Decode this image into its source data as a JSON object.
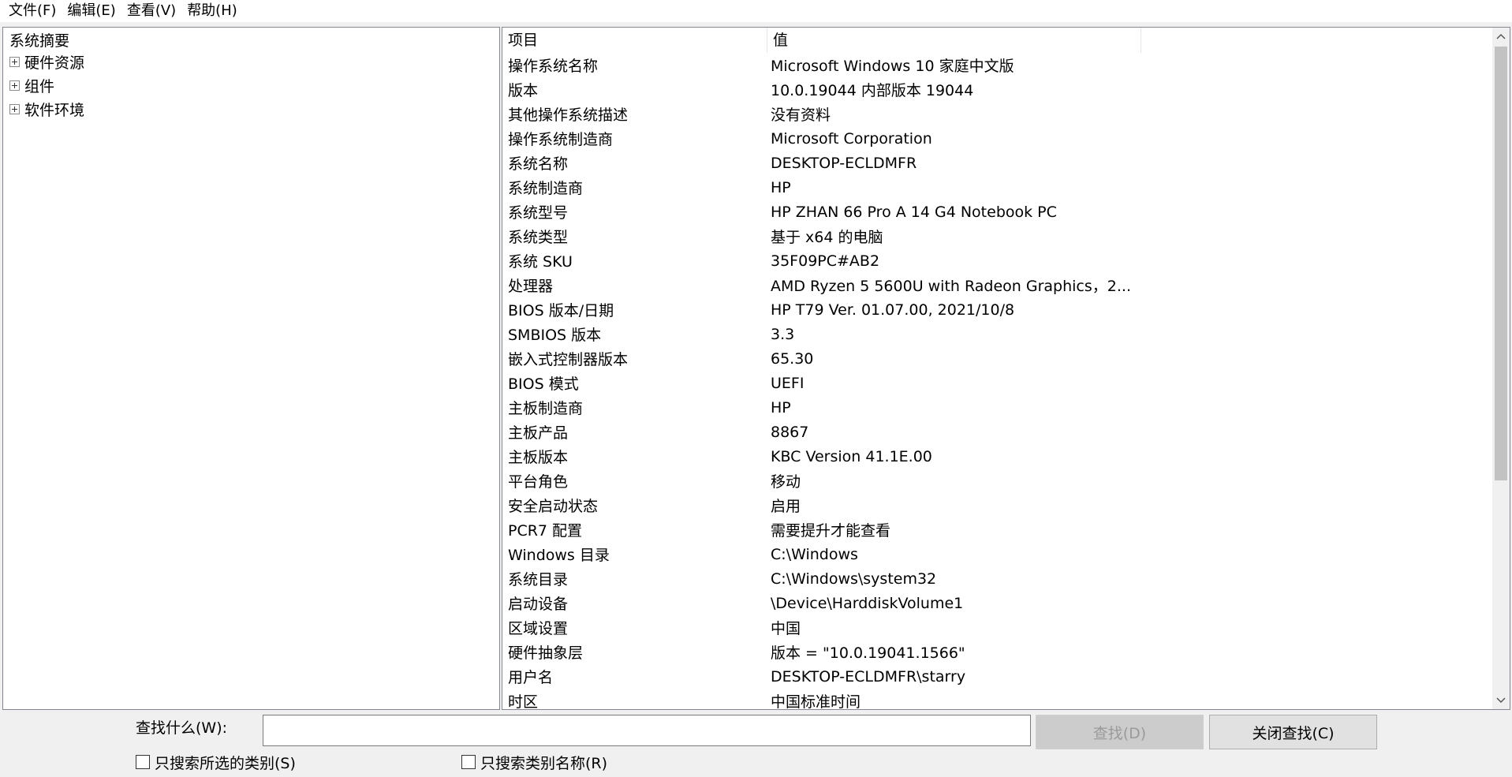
{
  "menu": {
    "file": "文件(F)",
    "edit": "编辑(E)",
    "view": "查看(V)",
    "help": "帮助(H)"
  },
  "tree": {
    "root": "系统摘要",
    "nodes": [
      "硬件资源",
      "组件",
      "软件环境"
    ]
  },
  "list": {
    "col_item": "项目",
    "col_value": "值",
    "rows": [
      {
        "k": "操作系统名称",
        "v": "Microsoft Windows 10 家庭中文版"
      },
      {
        "k": "版本",
        "v": "10.0.19044 内部版本 19044"
      },
      {
        "k": "其他操作系统描述",
        "v": "没有资料"
      },
      {
        "k": "操作系统制造商",
        "v": "Microsoft Corporation"
      },
      {
        "k": "系统名称",
        "v": "DESKTOP-ECLDMFR"
      },
      {
        "k": "系统制造商",
        "v": "HP"
      },
      {
        "k": "系统型号",
        "v": "HP ZHAN 66 Pro A 14 G4 Notebook PC"
      },
      {
        "k": "系统类型",
        "v": "基于 x64 的电脑"
      },
      {
        "k": "系统 SKU",
        "v": "35F09PC#AB2"
      },
      {
        "k": "处理器",
        "v": "AMD Ryzen 5 5600U with Radeon Graphics，2..."
      },
      {
        "k": "BIOS 版本/日期",
        "v": "HP T79 Ver. 01.07.00, 2021/10/8"
      },
      {
        "k": "SMBIOS 版本",
        "v": "3.3"
      },
      {
        "k": "嵌入式控制器版本",
        "v": "65.30"
      },
      {
        "k": "BIOS 模式",
        "v": "UEFI"
      },
      {
        "k": "主板制造商",
        "v": "HP"
      },
      {
        "k": "主板产品",
        "v": "8867"
      },
      {
        "k": "主板版本",
        "v": "KBC Version 41.1E.00"
      },
      {
        "k": "平台角色",
        "v": "移动"
      },
      {
        "k": "安全启动状态",
        "v": "启用"
      },
      {
        "k": "PCR7 配置",
        "v": "需要提升才能查看"
      },
      {
        "k": "Windows 目录",
        "v": "C:\\Windows"
      },
      {
        "k": "系统目录",
        "v": "C:\\Windows\\system32"
      },
      {
        "k": "启动设备",
        "v": "\\Device\\HarddiskVolume1"
      },
      {
        "k": "区域设置",
        "v": "中国"
      },
      {
        "k": "硬件抽象层",
        "v": "版本 = \"10.0.19041.1566\""
      },
      {
        "k": "用户名",
        "v": "DESKTOP-ECLDMFR\\starry"
      },
      {
        "k": "时区",
        "v": "中国标准时间"
      }
    ]
  },
  "find": {
    "label": "查找什么(W):",
    "input_value": "",
    "find_button": "查找(D)",
    "close_button": "关闭查找(C)",
    "check_selected": "只搜索所选的类别(S)",
    "check_names": "只搜索类别名称(R)"
  },
  "scroll": {
    "up_icon": "chevron-up-icon",
    "down_icon": "chevron-down-icon"
  }
}
